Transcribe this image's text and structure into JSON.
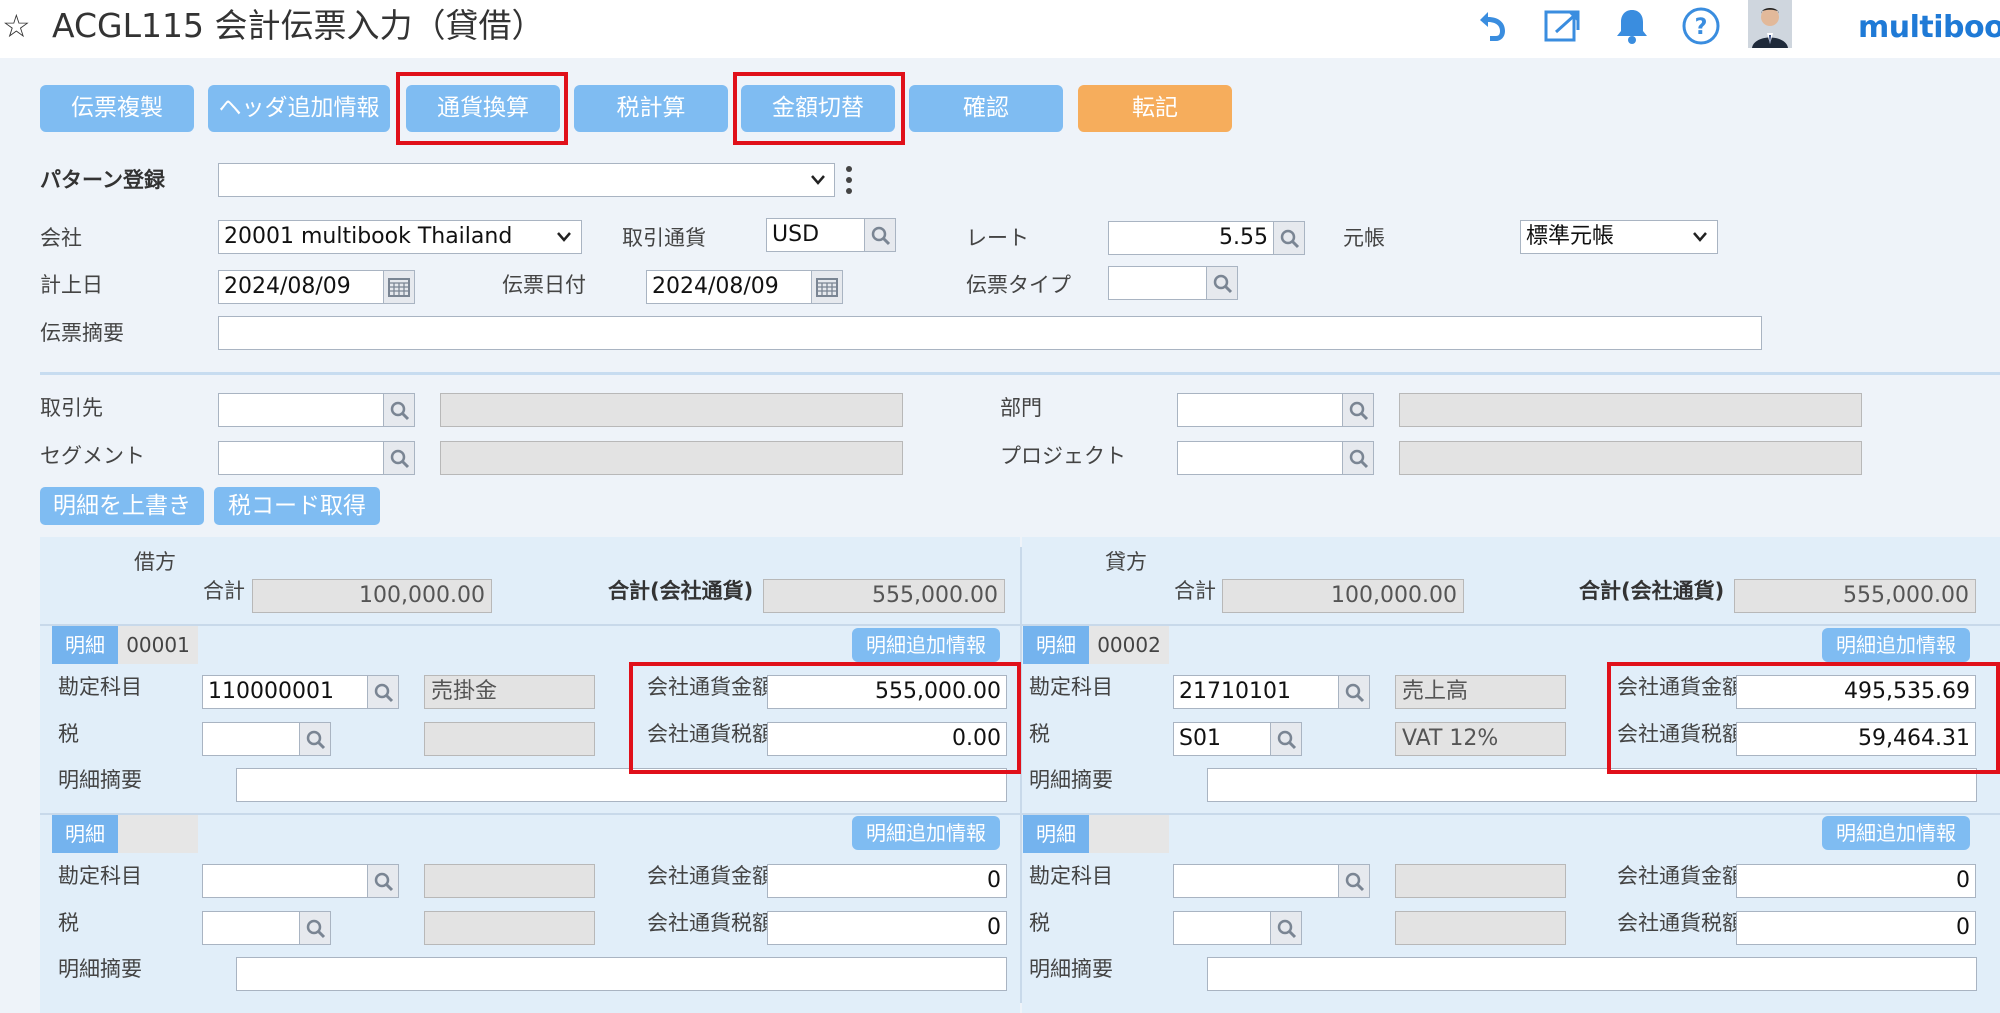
{
  "header": {
    "title": "ACGL115 会計伝票入力（貸借）",
    "brand": "multibook",
    "icons": [
      "star-icon",
      "undo-icon",
      "external-link-icon",
      "bell-icon",
      "help-icon",
      "user-avatar"
    ]
  },
  "toolbar": {
    "buttons": [
      "伝票複製",
      "ヘッダ追加情報",
      "通貨換算",
      "税計算",
      "金額切替",
      "確認",
      "転記"
    ]
  },
  "pattern": {
    "label": "パターン登録",
    "value": ""
  },
  "form": {
    "company_label": "会社",
    "company_value": "20001 multibook Thailand",
    "currency_label": "取引通貨",
    "currency_value": "USD",
    "rate_label": "レート",
    "rate_value": "5.55",
    "ledger_label": "元帳",
    "ledger_value": "標準元帳",
    "posting_date_label": "計上日",
    "posting_date_value": "2024/08/09",
    "voucher_date_label": "伝票日付",
    "voucher_date_value": "2024/08/09",
    "voucher_type_label": "伝票タイプ",
    "voucher_type_value": "",
    "memo_label": "伝票摘要",
    "memo_value": "",
    "partner_label": "取引先",
    "dept_label": "部門",
    "segment_label": "セグメント",
    "project_label": "プロジェクト"
  },
  "actions": {
    "overwrite": "明細を上書き",
    "taxcode": "税コード取得"
  },
  "debit": {
    "heading": "借方",
    "total_label": "合計",
    "total_value": "100,000.00",
    "total_company_label": "合計(会社通貨)",
    "total_company_value": "555,000.00",
    "lines": [
      {
        "tag": "明細",
        "num": "00001",
        "extra": "明細追加情報",
        "account_label": "勘定科目",
        "account": "110000001",
        "account_name": "売掛金",
        "tax_label": "税",
        "tax": "",
        "tax_name": "",
        "memo_label": "明細摘要",
        "amount_label": "会社通貨金額",
        "amount": "555,000.00",
        "tax_amount_label": "会社通貨税額",
        "tax_amount": "0.00"
      },
      {
        "tag": "明細",
        "num": "",
        "extra": "明細追加情報",
        "account_label": "勘定科目",
        "account": "",
        "account_name": "",
        "tax_label": "税",
        "tax": "",
        "tax_name": "",
        "memo_label": "明細摘要",
        "amount_label": "会社通貨金額",
        "amount": "0",
        "tax_amount_label": "会社通貨税額",
        "tax_amount": "0"
      }
    ]
  },
  "credit": {
    "heading": "貸方",
    "total_label": "合計",
    "total_value": "100,000.00",
    "total_company_label": "合計(会社通貨)",
    "total_company_value": "555,000.00",
    "lines": [
      {
        "tag": "明細",
        "num": "00002",
        "extra": "明細追加情報",
        "account_label": "勘定科目",
        "account": "21710101",
        "account_name": "売上高",
        "tax_label": "税",
        "tax": "S01",
        "tax_name": "VAT 12%",
        "memo_label": "明細摘要",
        "amount_label": "会社通貨金額",
        "amount": "495,535.69",
        "tax_amount_label": "会社通貨税額",
        "tax_amount": "59,464.31"
      },
      {
        "tag": "明細",
        "num": "",
        "extra": "明細追加情報",
        "account_label": "勘定科目",
        "account": "",
        "account_name": "",
        "tax_label": "税",
        "tax": "",
        "tax_name": "",
        "memo_label": "明細摘要",
        "amount_label": "会社通貨金額",
        "amount": "0",
        "tax_amount_label": "会社通貨税額",
        "tax_amount": "0"
      }
    ]
  }
}
